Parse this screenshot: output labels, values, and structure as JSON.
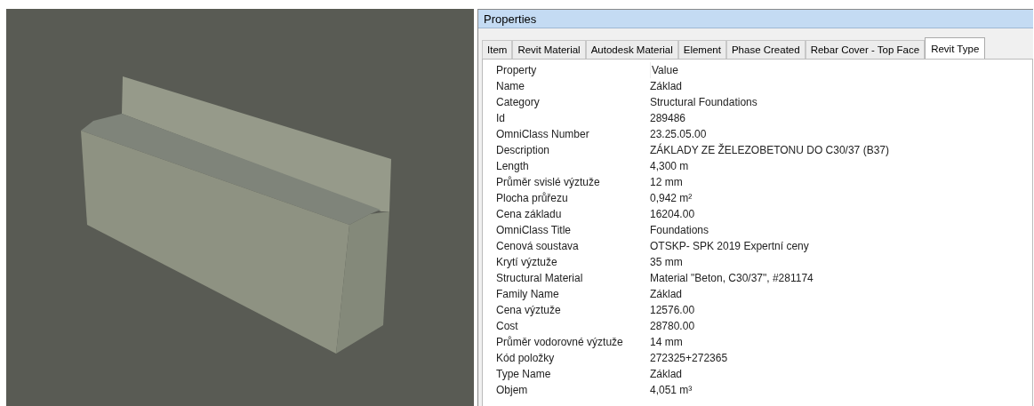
{
  "panel": {
    "title": "Properties"
  },
  "tabs": [
    {
      "label": "Item",
      "selected": false
    },
    {
      "label": "Revit Material",
      "selected": false
    },
    {
      "label": "Autodesk Material",
      "selected": false
    },
    {
      "label": "Element",
      "selected": false
    },
    {
      "label": "Phase Created",
      "selected": false
    },
    {
      "label": "Rebar Cover - Top Face",
      "selected": false
    },
    {
      "label": "Revit Type",
      "selected": true
    }
  ],
  "table": {
    "columns": [
      "Property",
      "Value"
    ],
    "rows": [
      [
        "Name",
        "Základ"
      ],
      [
        "Category",
        "Structural Foundations"
      ],
      [
        "Id",
        "289486"
      ],
      [
        "OmniClass Number",
        "23.25.05.00"
      ],
      [
        "Description",
        "ZÁKLADY ZE ŽELEZOBETONU DO C30/37 (B37)"
      ],
      [
        "Length",
        "4,300 m"
      ],
      [
        "Průměr svislé výztuže",
        "12 mm"
      ],
      [
        "Plocha průřezu",
        "0,942 m²"
      ],
      [
        "Cena základu",
        "16204.00"
      ],
      [
        "OmniClass Title",
        "Foundations"
      ],
      [
        "Cenová soustava",
        "OTSKP- SPK 2019 Expertní ceny"
      ],
      [
        "Krytí výztuže",
        "35 mm"
      ],
      [
        "Structural Material",
        "Material \"Beton, C30/37\", #281174"
      ],
      [
        "Family Name",
        "Základ"
      ],
      [
        "Cena výztuže",
        "12576.00"
      ],
      [
        "Cost",
        "28780.00"
      ],
      [
        "Průměr vodorovné výztuže",
        "14 mm"
      ],
      [
        "Kód položky",
        "272325+272365"
      ],
      [
        "Type Name",
        "Základ"
      ],
      [
        "Objem",
        "4,051 m³"
      ]
    ]
  }
}
